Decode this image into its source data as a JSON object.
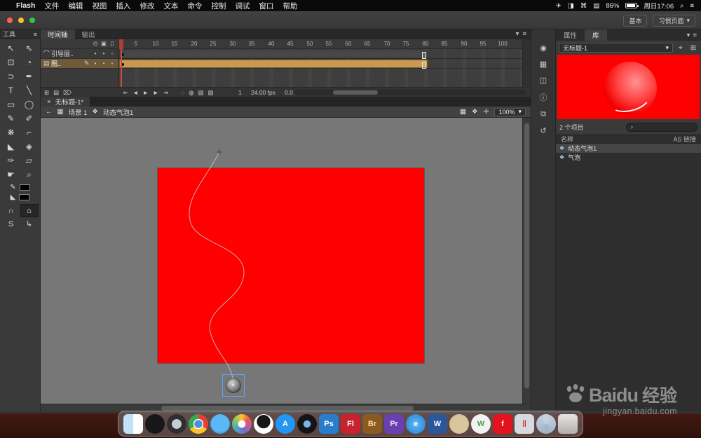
{
  "menubar": {
    "app_name": "Flash",
    "items": [
      "文件",
      "编辑",
      "视图",
      "插入",
      "修改",
      "文本",
      "命令",
      "控制",
      "调试",
      "窗口",
      "帮助"
    ],
    "status_icons": [
      "✈",
      "◨",
      "⌘",
      "▤"
    ],
    "battery": "86%",
    "clock": "周日17:06"
  },
  "titlebar": {
    "workspace_mode": "基本",
    "workspace_name": "习惯页面"
  },
  "panels": {
    "timeline_tab": "时间轴",
    "output_tab": "输出",
    "properties_tab": "属性",
    "library_tab": "库",
    "tools_title": "工具"
  },
  "timeline": {
    "layers": [
      {
        "name": "引导层.."
      },
      {
        "name": "图.."
      }
    ],
    "ruler": [
      "1",
      "5",
      "10",
      "15",
      "20",
      "25",
      "30",
      "35",
      "40",
      "45",
      "50",
      "55",
      "60",
      "65",
      "70",
      "75",
      "80",
      "85",
      "90",
      "95",
      "100"
    ],
    "current_frame": "1",
    "frame_rate": "24.00 fps",
    "elapsed_time": "0.0 s"
  },
  "document": {
    "tab_title": "无标题-1*"
  },
  "editbar": {
    "scene": "场景 1",
    "symbol": "动态气泡1",
    "zoom": "100%"
  },
  "library": {
    "doc_name": "无标题-1",
    "item_count": "2 个项目",
    "col_name": "名称",
    "col_linkage": "AS 链接",
    "items": [
      {
        "label": "动态气泡1"
      },
      {
        "label": "气泡"
      }
    ]
  },
  "tools": {
    "list": [
      {
        "name": "selection",
        "glyph": "↖"
      },
      {
        "name": "subselection",
        "glyph": "⇖"
      },
      {
        "name": "free-transform",
        "glyph": "⊡"
      },
      {
        "name": "3d-rotation",
        "glyph": "◔"
      },
      {
        "name": "lasso",
        "glyph": "⊃"
      },
      {
        "name": "pen",
        "glyph": "✒"
      },
      {
        "name": "text",
        "glyph": "T"
      },
      {
        "name": "line",
        "glyph": "╲"
      },
      {
        "name": "rectangle",
        "glyph": "▭"
      },
      {
        "name": "oval",
        "glyph": "◯"
      },
      {
        "name": "pencil",
        "glyph": "✎"
      },
      {
        "name": "brush",
        "glyph": "✐"
      },
      {
        "name": "deco",
        "glyph": "❋"
      },
      {
        "name": "bone",
        "glyph": "⌐"
      },
      {
        "name": "paint-bucket",
        "glyph": "◣"
      },
      {
        "name": "ink-bottle",
        "glyph": "◈"
      },
      {
        "name": "eyedropper",
        "glyph": "✑"
      },
      {
        "name": "eraser",
        "glyph": "▱"
      },
      {
        "name": "hand",
        "glyph": "☛"
      },
      {
        "name": "zoom",
        "glyph": "⌕"
      }
    ],
    "options": [
      {
        "name": "snap",
        "glyph": "∩"
      },
      {
        "name": "object-drawing",
        "glyph": "⌂"
      },
      {
        "name": "bind",
        "glyph": "S"
      },
      {
        "name": "orient",
        "glyph": "↳"
      }
    ]
  },
  "rightstrip": [
    {
      "name": "color",
      "glyph": "◉"
    },
    {
      "name": "swatches",
      "glyph": "▦"
    },
    {
      "name": "align",
      "glyph": "◫"
    },
    {
      "name": "info",
      "glyph": "ⓘ"
    },
    {
      "name": "transform",
      "glyph": "⧉"
    },
    {
      "name": "history",
      "glyph": "↺"
    }
  ],
  "glyphs": {
    "apple": "",
    "caret_down": "▾",
    "menu": "≡",
    "close": "×",
    "search": "⌕",
    "spotlight": "⌕",
    "back": "←",
    "edit_scene": "▦",
    "edit_symbol": "❖",
    "center_frame": "✛",
    "eye": "⊙",
    "lock": "▣",
    "outline": "▯",
    "guide_layer": "⌒",
    "layer": "▤",
    "pencil": "✎",
    "dot": "•",
    "square_hollow": "▫",
    "square_filled": "▪",
    "new_layer": "⊞",
    "folder": "▤",
    "trash": "⌦",
    "first_frame": "⇤",
    "prev_frame": "◄",
    "play": "►",
    "last_frame": "⇥",
    "onion1": "◌",
    "onion2": "◍",
    "onion3": "▧",
    "onion4": "▨",
    "pin": "⌖",
    "new_panel": "⊞"
  },
  "dock": {
    "items": [
      {
        "label": "",
        "css": "background:linear-gradient(90deg,#bfe3f9 50%,#ffffff 50%);border-radius:6px"
      },
      {
        "label": "",
        "css": "background:#17171a;border-radius:50%"
      },
      {
        "label": "",
        "css": "background:radial-gradient(circle,#c7ccd1 34%,#2e2e33 36%);border-radius:50%"
      },
      {
        "label": "",
        "css": "background:radial-gradient(circle,#4a90e2 28%,#ffffff 30% 36%,rgba(0,0,0,0) 37%),conic-gradient(#e84133 0 120deg,#fcc32d 120deg 240deg,#34a853 240deg 360deg);border-radius:50%"
      },
      {
        "label": "",
        "css": "background:radial-gradient(circle at 50% 45%,#59b8f5 55%,#1c78d3);border-radius:50%"
      },
      {
        "label": "",
        "css": "background:radial-gradient(circle,#ffffff 26%,rgba(255,255,255,0) 28%),conic-gradient(#f9c232,#ee5b47,#c65b9c,#7d6bc1,#4f94d8,#55b9a2,#9cc75a,#f9c232);border-radius:50%"
      },
      {
        "label": "",
        "css": "background:radial-gradient(circle at 50% 38%,#17171a 42%,#ffffff 44%);border-radius:50%"
      },
      {
        "label": "A",
        "css": "background:#2397f3;border-radius:50%;color:#fff"
      },
      {
        "label": "",
        "css": "background:radial-gradient(circle,#79b6e8 24%,#141416 28%);border-radius:50%"
      },
      {
        "label": "Ps",
        "css": "background:#2a7ccc;color:#ffffff"
      },
      {
        "label": "Fl",
        "css": "background:#c7222e;color:#ffffff"
      },
      {
        "label": "Br",
        "css": "background:#8a5a20;color:#ffd9a0"
      },
      {
        "label": "Pr",
        "css": "background:#6a3fb0;color:#e8dcff"
      },
      {
        "label": "e",
        "css": "background:radial-gradient(circle,#63b9f2,#1e7fd6);border-radius:50%;color:#fff"
      },
      {
        "label": "W",
        "css": "background:#2b579a;color:#ffffff"
      },
      {
        "label": "",
        "css": "background:#d9c59b;border-radius:50%"
      },
      {
        "label": "W",
        "css": "background:#f2f2f2;color:#44a340;border-radius:50%"
      },
      {
        "label": "f",
        "css": "background:#e2121f;color:#ffffff"
      },
      {
        "label": "||",
        "css": "background:#d6d9de;color:#d6323c;font-size:10px"
      },
      {
        "label": "",
        "css": "background:conic-gradient(from 180deg,#9fb3c8,#c8d4e0,#9fb3c8);border-radius:50%"
      },
      {
        "label": "",
        "css": "background:linear-gradient(180deg,rgba(255,255,255,.85),rgba(200,200,200,.8));border-radius:5px"
      }
    ]
  },
  "watermark": {
    "brand": "Baidu",
    "suffix": "经验",
    "url": "jingyan.baidu.com"
  },
  "colors": {
    "stage_red": "#ff0000",
    "tween_span": "#c69a52",
    "selection_blue": "#58a6ff"
  }
}
